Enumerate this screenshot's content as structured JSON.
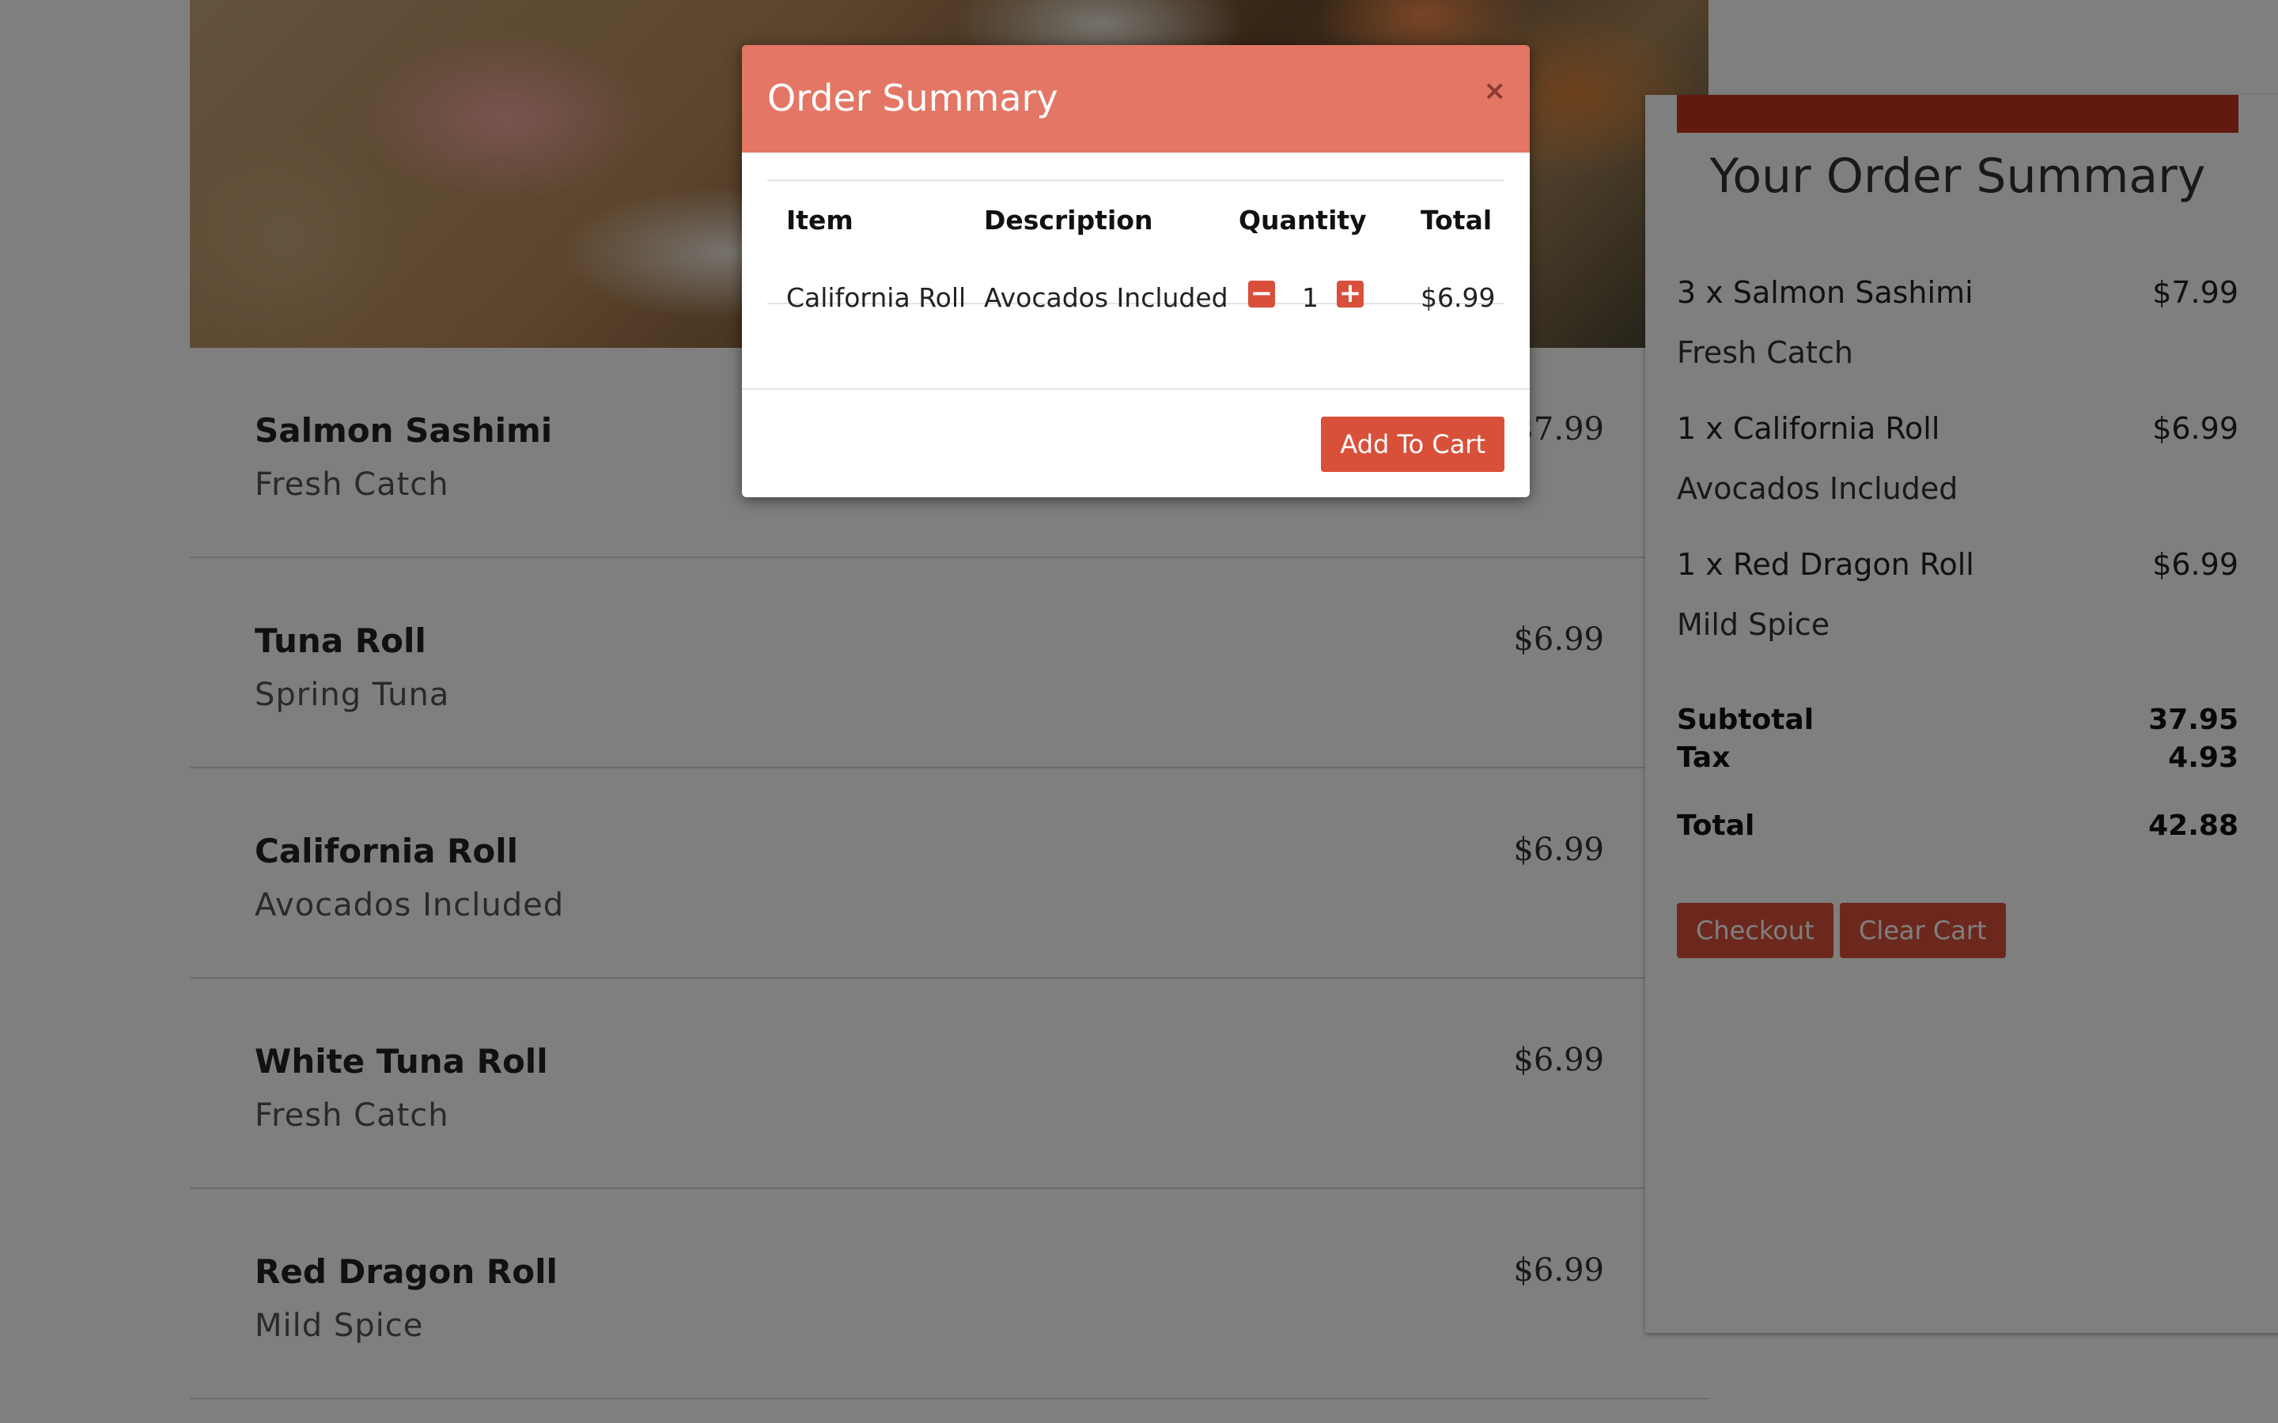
{
  "menu": {
    "items": [
      {
        "name": "Salmon Sashimi",
        "desc": "Fresh Catch",
        "price": "$7.99"
      },
      {
        "name": "Tuna Roll",
        "desc": "Spring Tuna",
        "price": "$6.99"
      },
      {
        "name": "California Roll",
        "desc": "Avocados Included",
        "price": "$6.99"
      },
      {
        "name": "White Tuna Roll",
        "desc": "Fresh Catch",
        "price": "$6.99"
      },
      {
        "name": "Red Dragon Roll",
        "desc": "Mild Spice",
        "price": "$6.99"
      }
    ]
  },
  "summary": {
    "title": "Your Order Summary",
    "lines": [
      {
        "qty_name": "3 x Salmon Sashimi",
        "price": "$7.99",
        "desc": "Fresh Catch"
      },
      {
        "qty_name": "1 x California Roll",
        "price": "$6.99",
        "desc": "Avocados Included"
      },
      {
        "qty_name": "1 x Red Dragon Roll",
        "price": "$6.99",
        "desc": "Mild Spice"
      }
    ],
    "subtotal_label": "Subtotal",
    "subtotal_value": "37.95",
    "tax_label": "Tax",
    "tax_value": "4.93",
    "total_label": "Total",
    "total_value": "42.88",
    "checkout_label": "Checkout",
    "clear_label": "Clear Cart"
  },
  "modal": {
    "title": "Order Summary",
    "close_glyph": "×",
    "headers": {
      "item": "Item",
      "description": "Description",
      "quantity": "Quantity",
      "total": "Total"
    },
    "row": {
      "item": "California Roll",
      "description": "Avocados Included",
      "quantity": "1",
      "total": "$6.99"
    },
    "minus_glyph": "−",
    "plus_glyph": "+",
    "add_label": "Add To Cart"
  },
  "colors": {
    "accent": "#d9503a",
    "modal_header": "#e37664",
    "summary_bar": "#c5341f"
  }
}
